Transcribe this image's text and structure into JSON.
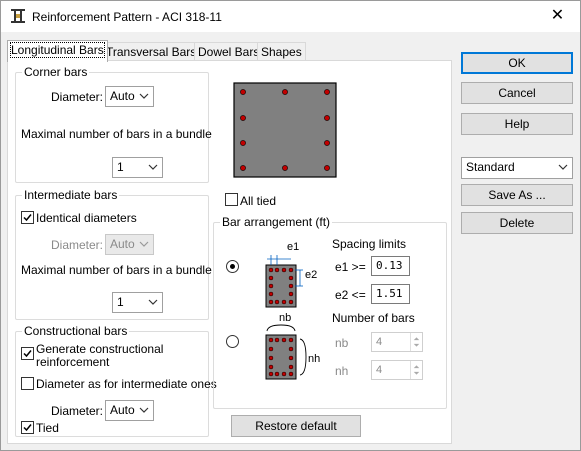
{
  "window": {
    "title": "Reinforcement Pattern - ACI 318-11",
    "close_glyph": "✕"
  },
  "tabs": [
    {
      "label": "Longitudinal Bars",
      "active": true
    },
    {
      "label": "Transversal Bars"
    },
    {
      "label": "Dowel Bars"
    },
    {
      "label": "Shapes"
    }
  ],
  "corner_bars": {
    "title": "Corner bars",
    "diameter_label": "Diameter:",
    "diameter_value": "Auto",
    "bundle_label": "Maximal number of bars in a bundle",
    "bundle_value": "1"
  },
  "intermediate_bars": {
    "title": "Intermediate bars",
    "identical_label": "Identical diameters",
    "identical_checked": true,
    "diameter_label": "Diameter:",
    "diameter_value": "Auto",
    "bundle_label": "Maximal number of bars in a bundle",
    "bundle_value": "1"
  },
  "constructional_bars": {
    "title": "Constructional bars",
    "generate_label_1": "Generate constructional",
    "generate_label_2": "reinforcement",
    "generate_checked": true,
    "diam_as_label": "Diameter as for intermediate ones",
    "diam_as_checked": false,
    "diameter_label": "Diameter:",
    "diameter_value": "Auto",
    "tied_label": "Tied",
    "tied_checked": true
  },
  "all_tied": {
    "label": "All tied",
    "checked": false
  },
  "bar_arrangement": {
    "title": "Bar arrangement (ft)",
    "spacing_limits_label": "Spacing limits",
    "e1_label": "e1 >=",
    "e1_value": "0.13",
    "e2_label": "e2 <=",
    "e2_value": "1.51",
    "number_of_bars_label": "Number of bars",
    "nb_label": "nb",
    "nb_value": "4",
    "nh_label": "nh",
    "nh_value": "4",
    "diagram1_e1": "e1",
    "diagram1_e2": "e2",
    "diagram2_nb": "nb",
    "diagram2_nh": "nh"
  },
  "buttons": {
    "restore": "Restore default",
    "ok": "OK",
    "cancel": "Cancel",
    "help": "Help",
    "save_as": "Save As ...",
    "delete": "Delete"
  },
  "preset": {
    "value": "Standard"
  },
  "colors": {
    "accent": "#0078d7",
    "concrete": "#808080",
    "bar": "#c00000"
  }
}
